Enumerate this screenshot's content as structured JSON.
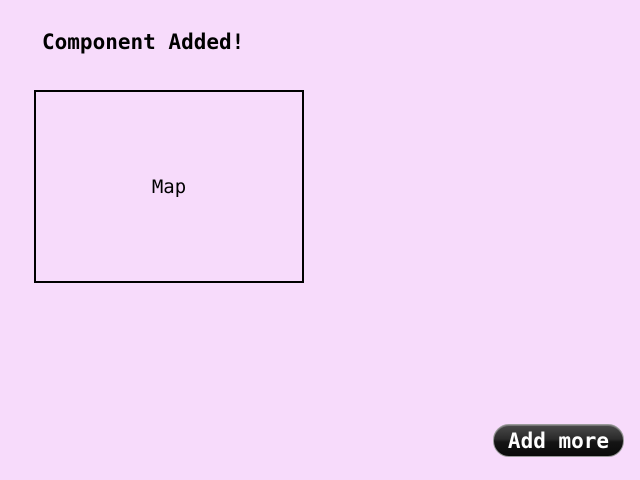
{
  "header": {
    "title": "Component Added!"
  },
  "map_component": {
    "label": "Map"
  },
  "actions": {
    "add_more_label": "Add more"
  },
  "colors": {
    "background": "#f7dbfb",
    "button_background": "#1a1a1a",
    "button_text": "#ffffff",
    "border": "#000000"
  }
}
